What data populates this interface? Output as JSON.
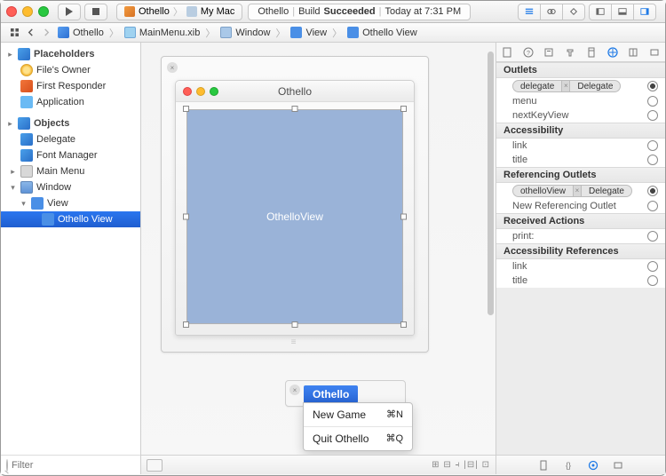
{
  "toolbar": {
    "scheme_name": "Othello",
    "scheme_dest": "My Mac",
    "status_project": "Othello",
    "status_build": "Build",
    "status_result": "Succeeded",
    "status_time": "Today at 7:31 PM"
  },
  "jumpbar": {
    "items": [
      "Othello",
      "MainMenu.xib",
      "Window",
      "View",
      "Othello View"
    ]
  },
  "navigator": {
    "placeholders_hdr": "Placeholders",
    "files_owner": "File's Owner",
    "first_responder": "First Responder",
    "application": "Application",
    "objects_hdr": "Objects",
    "delegate": "Delegate",
    "font_manager": "Font Manager",
    "main_menu": "Main Menu",
    "window": "Window",
    "view": "View",
    "othello_view": "Othello View",
    "filter_placeholder": "Filter"
  },
  "canvas": {
    "window_title": "Othello",
    "custom_view_label": "OthelloView",
    "menu_title": "Othello",
    "menu_items": [
      {
        "label": "New Game",
        "shortcut": "⌘N"
      },
      {
        "label": "Quit Othello",
        "shortcut": "⌘Q"
      }
    ]
  },
  "inspector": {
    "sections": {
      "outlets": {
        "title": "Outlets",
        "rows": [
          {
            "name": "delegate",
            "link_src": "delegate",
            "link_dst": "Delegate",
            "connected": true
          },
          {
            "name": "menu",
            "connected": false
          },
          {
            "name": "nextKeyView",
            "connected": false
          }
        ]
      },
      "accessibility": {
        "title": "Accessibility",
        "rows": [
          {
            "name": "link",
            "connected": false
          },
          {
            "name": "title",
            "connected": false
          }
        ]
      },
      "ref_outlets": {
        "title": "Referencing Outlets",
        "rows": [
          {
            "name": "othelloView",
            "link_src": "othelloView",
            "link_dst": "Delegate",
            "connected": true
          },
          {
            "name": "New Referencing Outlet",
            "connected": false
          }
        ]
      },
      "received_actions": {
        "title": "Received Actions",
        "rows": [
          {
            "name": "print:",
            "connected": false
          }
        ]
      },
      "acc_refs": {
        "title": "Accessibility References",
        "rows": [
          {
            "name": "link",
            "connected": false
          },
          {
            "name": "title",
            "connected": false
          }
        ]
      }
    },
    "footer_label": "[⊞]"
  }
}
